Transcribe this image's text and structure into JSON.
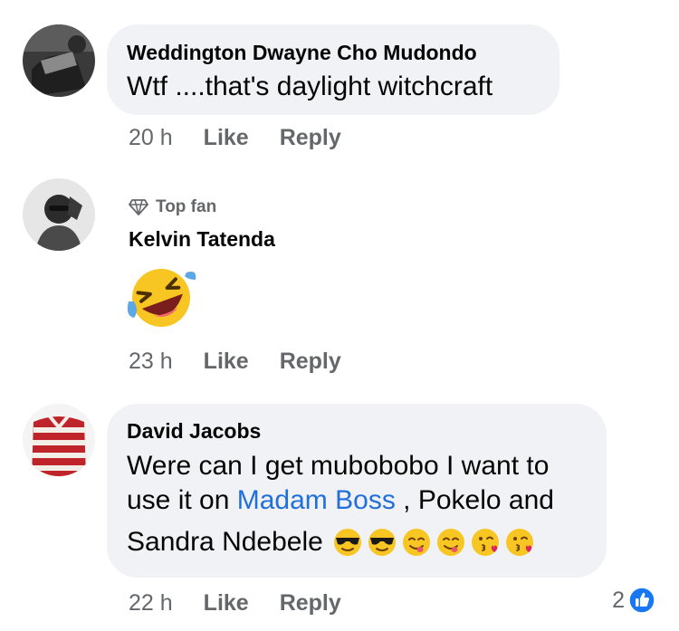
{
  "comments": [
    {
      "author": "Weddington Dwayne Cho Mudondo",
      "text": "Wtf ....that's daylight witchcraft",
      "time": "20 h",
      "like_label": "Like",
      "reply_label": "Reply"
    },
    {
      "badge": "Top fan",
      "author": "Kelvin Tatenda",
      "sticker": "rolling-laughing-emoji",
      "time": "23 h",
      "like_label": "Like",
      "reply_label": "Reply"
    },
    {
      "author": "David Jacobs",
      "line1": "Were can I get mubobobo I want to",
      "line2_prefix": "use it on ",
      "mention": "Madam Boss",
      "line2_suffix": " , Pokelo and",
      "line3": "Sandra Ndebele",
      "emojis": [
        "sunglasses-face",
        "sunglasses-face",
        "yum-face",
        "yum-face",
        "kissing-heart-face",
        "kissing-heart-face"
      ],
      "time": "22 h",
      "like_label": "Like",
      "reply_label": "Reply",
      "reaction_count": "2"
    }
  ],
  "colors": {
    "bubble": "#f0f2f5",
    "link": "#216fdb",
    "meta": "#65676b",
    "like_blue": "#1877f2"
  }
}
